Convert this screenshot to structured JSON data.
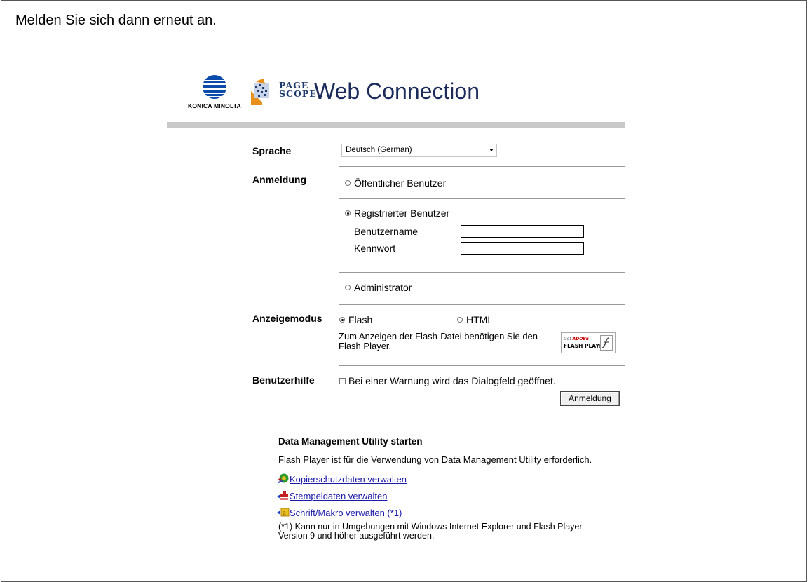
{
  "instruction": "Melden Sie sich dann erneut an.",
  "brand": {
    "maker": "KONICA MINOLTA",
    "product_small_line1": "PAGE",
    "product_small_line2": "SCOPE",
    "product_name": "Web Connection"
  },
  "language": {
    "label": "Sprache",
    "selected": "Deutsch (German)"
  },
  "login": {
    "label": "Anmeldung",
    "public_user": "Öffentlicher Benutzer",
    "registered_user": "Registrierter Benutzer",
    "username_label": "Benutzername",
    "password_label": "Kennwort",
    "administrator": "Administrator",
    "selected": "Registrierter Benutzer"
  },
  "display_mode": {
    "label": "Anzeigemodus",
    "flash": "Flash",
    "html": "HTML",
    "selected": "Flash",
    "note_line1": "Zum Anzeigen der Flash-Datei benötigen Sie den",
    "note_line2": "Flash Player.",
    "badge_get": "Get",
    "badge_adobe": "ADOBE",
    "badge_flash": "FLASH PLAYER"
  },
  "user_help": {
    "label": "Benutzerhilfe",
    "checkbox_text": "Bei einer Warnung wird das Dialogfeld geöffnet.",
    "checked": false
  },
  "login_button": "Anmeldung",
  "dmu": {
    "title": "Data Management Utility starten",
    "description": "Flash Player ist für die Verwendung von Data Management Utility erforderlich.",
    "links": [
      "Kopierschutzdaten verwalten",
      "Stempeldaten verwalten",
      "Schrift/Makro verwalten (*1)"
    ],
    "footnote_line1": "(*1) Kann nur in Umgebungen mit Windows Internet Explorer und Flash Player",
    "footnote_line2": "Version 9 und höher ausgeführt werden."
  },
  "colors": {
    "km_blue": "#0a4aa8",
    "pagescope_orange": "#e8901c",
    "pagescope_navy": "#1c2c5a",
    "link": "#1a1aaa",
    "divider_bar": "#c8c8c8"
  }
}
